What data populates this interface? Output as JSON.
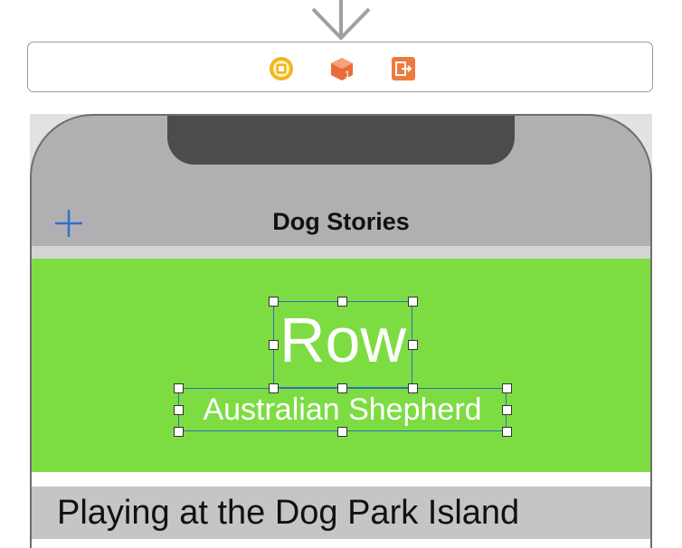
{
  "entry_point": {
    "icon": "down-arrow-icon"
  },
  "scene_dock": {
    "icons": [
      "view-controller-icon",
      "first-responder-icon",
      "exit-icon"
    ],
    "colors": {
      "view_controller": "#f2b51b",
      "first_responder": "#e96d3b",
      "exit": "#ef7a3d"
    }
  },
  "nav_bar": {
    "title": "Dog Stories",
    "add_icon": "plus-icon",
    "tint_color": "#2f6fd1"
  },
  "cells": [
    {
      "title": "Row",
      "subtitle": "Australian Shepherd",
      "background": "#7edc43",
      "selected": true
    },
    {
      "title": "Playing at the Dog Park Island",
      "background": "#c5c5c7"
    }
  ],
  "colors": {
    "selection_outline": "#2c6fb5",
    "device_chrome": "#b0b0b2",
    "notch": "#4c4c4c"
  }
}
